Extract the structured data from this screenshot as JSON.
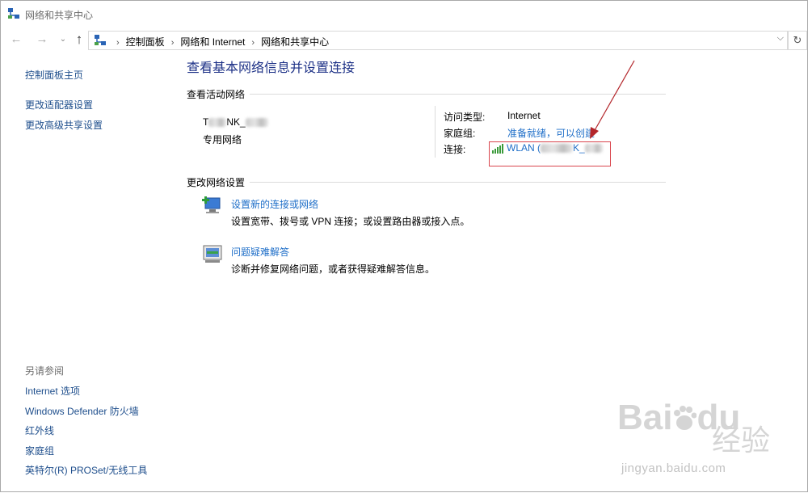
{
  "window": {
    "title": "网络和共享中心"
  },
  "address_bar": {
    "crumbs": [
      "控制面板",
      "网络和 Internet",
      "网络和共享中心"
    ]
  },
  "left_pane": {
    "links": [
      "控制面板主页",
      "更改适配器设置",
      "更改高级共享设置"
    ],
    "see_also_title": "另请参阅",
    "see_also": [
      "Internet 选项",
      "Windows Defender 防火墙",
      "红外线",
      "家庭组",
      "英特尔(R) PROSet/无线工具"
    ]
  },
  "main": {
    "title": "查看基本网络信息并设置连接",
    "active_networks_title": "查看活动网络",
    "network_name_visible": "T",
    "network_name_tail": "NK_",
    "network_type": "专用网络",
    "access_type_label": "访问类型:",
    "access_type_value": "Internet",
    "homegroup_label": "家庭组:",
    "homegroup_value": "准备就绪，可以创建",
    "connection_label": "连接:",
    "connection_value": "WLAN (",
    "connection_tail": "K_",
    "change_settings_title": "更改网络设置",
    "tasks": [
      {
        "link": "设置新的连接或网络",
        "desc": "设置宽带、拨号或 VPN 连接；或设置路由器或接入点。"
      },
      {
        "link": "问题疑难解答",
        "desc": "诊断并修复网络问题，或者获得疑难解答信息。"
      }
    ]
  },
  "watermark": {
    "logo_text": "Bai",
    "logo_text2": "du",
    "cn_text": "经验",
    "url": "jingyan.baidu.com"
  },
  "colors": {
    "link": "#1e6ec8",
    "title": "#1e3287",
    "annotation": "#d9464e"
  }
}
